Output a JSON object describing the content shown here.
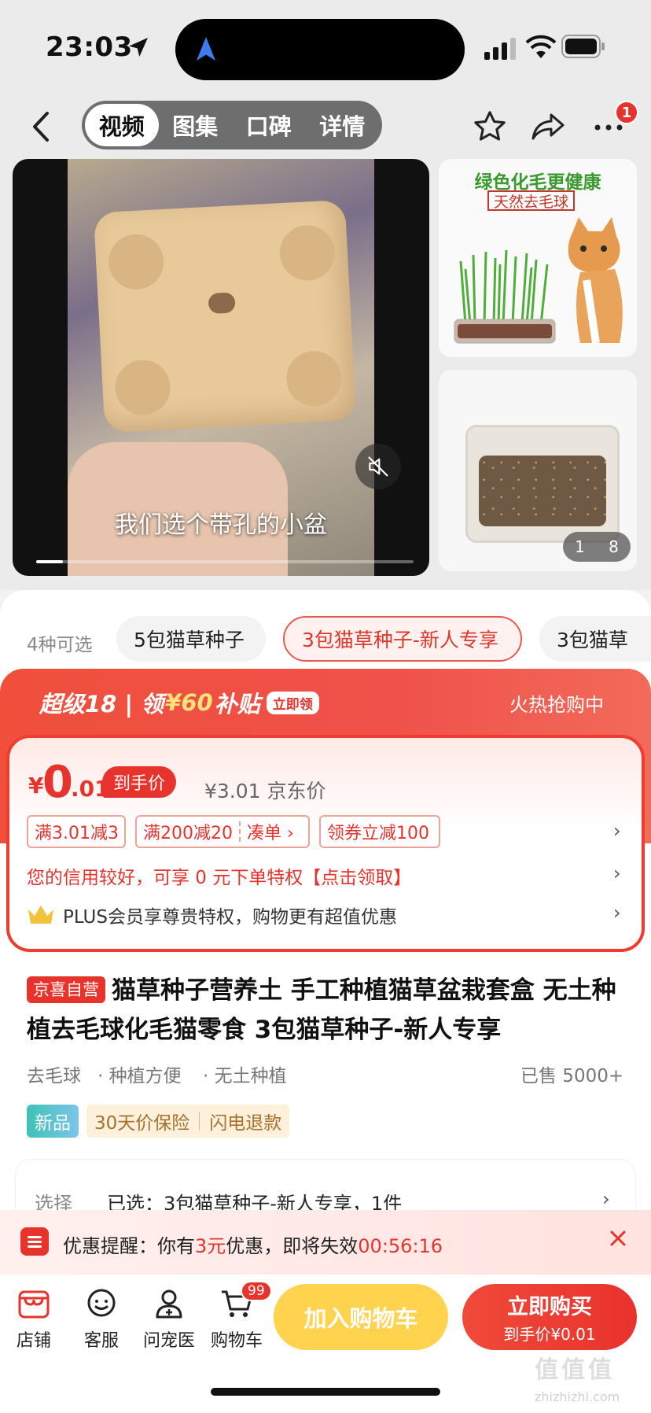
{
  "status_bar": {
    "time": "23:03"
  },
  "header": {
    "tabs": [
      {
        "label": "视频",
        "active": true
      },
      {
        "label": "图集",
        "active": false
      },
      {
        "label": "口碑",
        "active": false
      },
      {
        "label": "详情",
        "active": false
      }
    ],
    "more_badge": "1"
  },
  "media": {
    "video_caption": "我们选个带孔的小盆",
    "video_progress": 0.07,
    "thumb_1_title": "绿色化毛更健康",
    "thumb_1_subtitle": "天然去毛球",
    "image_counter_current": "1",
    "image_counter_total": "8"
  },
  "variants": {
    "count_label": "4种可选",
    "chips": [
      {
        "label": "5包猫草种子"
      },
      {
        "label": "3包猫草种子-新人专享",
        "selected": true
      },
      {
        "label": "3包猫草"
      }
    ]
  },
  "promo": {
    "prefix": "超级18 | 领",
    "amount": "¥60",
    "suffix": "补贴",
    "claim": "立即领",
    "status": "火热抢购中"
  },
  "price": {
    "currency": "¥",
    "integer": "0",
    "decimal": ".01",
    "tag": "到手价",
    "jd_price": "¥3.01 京东价"
  },
  "coupons": {
    "c1": "满3.01减3",
    "c2": "满200减20",
    "c2_action": "凑单 ›",
    "c3": "领券立减100"
  },
  "credit_row": "您的信用较好，可享 0 元下单特权【点击领取】",
  "plus_row": "PLUS会员享尊贵特权，购物更有超值优惠",
  "product": {
    "badge": "京喜自营",
    "title": "猫草种子营养土 手工种植猫草盆栽套盒 无土种植去毛球化毛猫零食 3包猫草种子-新人专享",
    "features": [
      "去毛球",
      "· 种植方便",
      "· 无土种植"
    ],
    "sold": "已售 5000+",
    "new_badge": "新品",
    "services": [
      "30天价保险",
      "闪电退款"
    ]
  },
  "selection": {
    "label": "选择",
    "value": "已选：3包猫草种子-新人专享，1件"
  },
  "reminder": {
    "prefix": "优惠提醒：你有",
    "amount": "3元",
    "middle": "优惠，即将失效",
    "countdown": "00:56:16"
  },
  "bottom_bar": {
    "store": "店铺",
    "service": "客服",
    "vet": "问宠医",
    "cart": "购物车",
    "cart_badge": "99",
    "add_cart": "加入购物车",
    "buy_now": "立即购买",
    "buy_now_price": "到手价¥0.01"
  },
  "watermark": {
    "main": "值值值",
    "sub": "zhizhizhi.com"
  },
  "colors": {
    "accent": "#e8332d",
    "add_cart": "#ffd34d",
    "new_badge": "#3fc2b6"
  }
}
